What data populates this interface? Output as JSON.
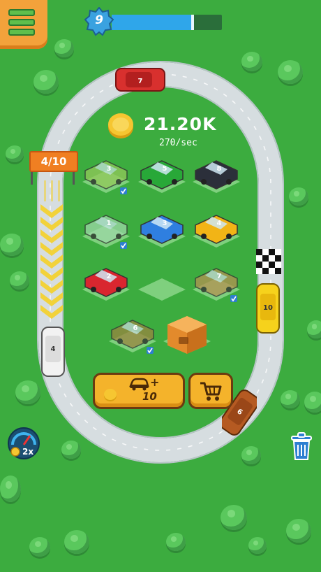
{
  "hud": {
    "level": "9",
    "level_progress": 0.72,
    "coins": "21.20K",
    "rate": "270/sec"
  },
  "track": {
    "lap_counter": "4/10"
  },
  "cars_on_track": [
    {
      "level": "7",
      "color": "#d8302e"
    },
    {
      "level": "4",
      "color": "#f2f2f2"
    },
    {
      "level": "10",
      "color": "#f6d21c"
    },
    {
      "level": "6",
      "color": "#b55a22"
    }
  ],
  "garage": [
    {
      "level": "3",
      "color": "#93c95a",
      "state": "ghost"
    },
    {
      "level": "5",
      "color": "#28a838",
      "state": "idle"
    },
    {
      "level": "8",
      "color": "#2b2f3a",
      "state": "idle"
    },
    {
      "level": "1",
      "color": "#9ed9a8",
      "state": "ghost"
    },
    {
      "level": "3",
      "color": "#2f7fe0",
      "state": "idle"
    },
    {
      "level": "4",
      "color": "#f2b416",
      "state": "idle"
    },
    {
      "level": "2",
      "color": "#d9262f",
      "state": "idle"
    },
    {
      "level": "",
      "color": "",
      "state": "empty"
    },
    {
      "level": "7",
      "color": "#b59252",
      "state": "ghost"
    },
    {
      "level": "6",
      "color": "#9a8540",
      "state": "ghost"
    },
    {
      "level": "",
      "color": "#f0a23e",
      "state": "crate"
    }
  ],
  "buttons": {
    "buy_car_plus": "+",
    "buy_car_price": "10",
    "speed_boost": "2x"
  },
  "colors": {
    "grass": "#3cac3f",
    "track": "#d6dde0",
    "button": "#f4b32b",
    "accent_blue": "#2fa6ea"
  },
  "icons": [
    "menu-icon",
    "level-star-icon",
    "coin-icon",
    "car-icon",
    "shopping-cart-icon",
    "speedometer-icon",
    "trash-icon",
    "checkered-flag-icon"
  ]
}
